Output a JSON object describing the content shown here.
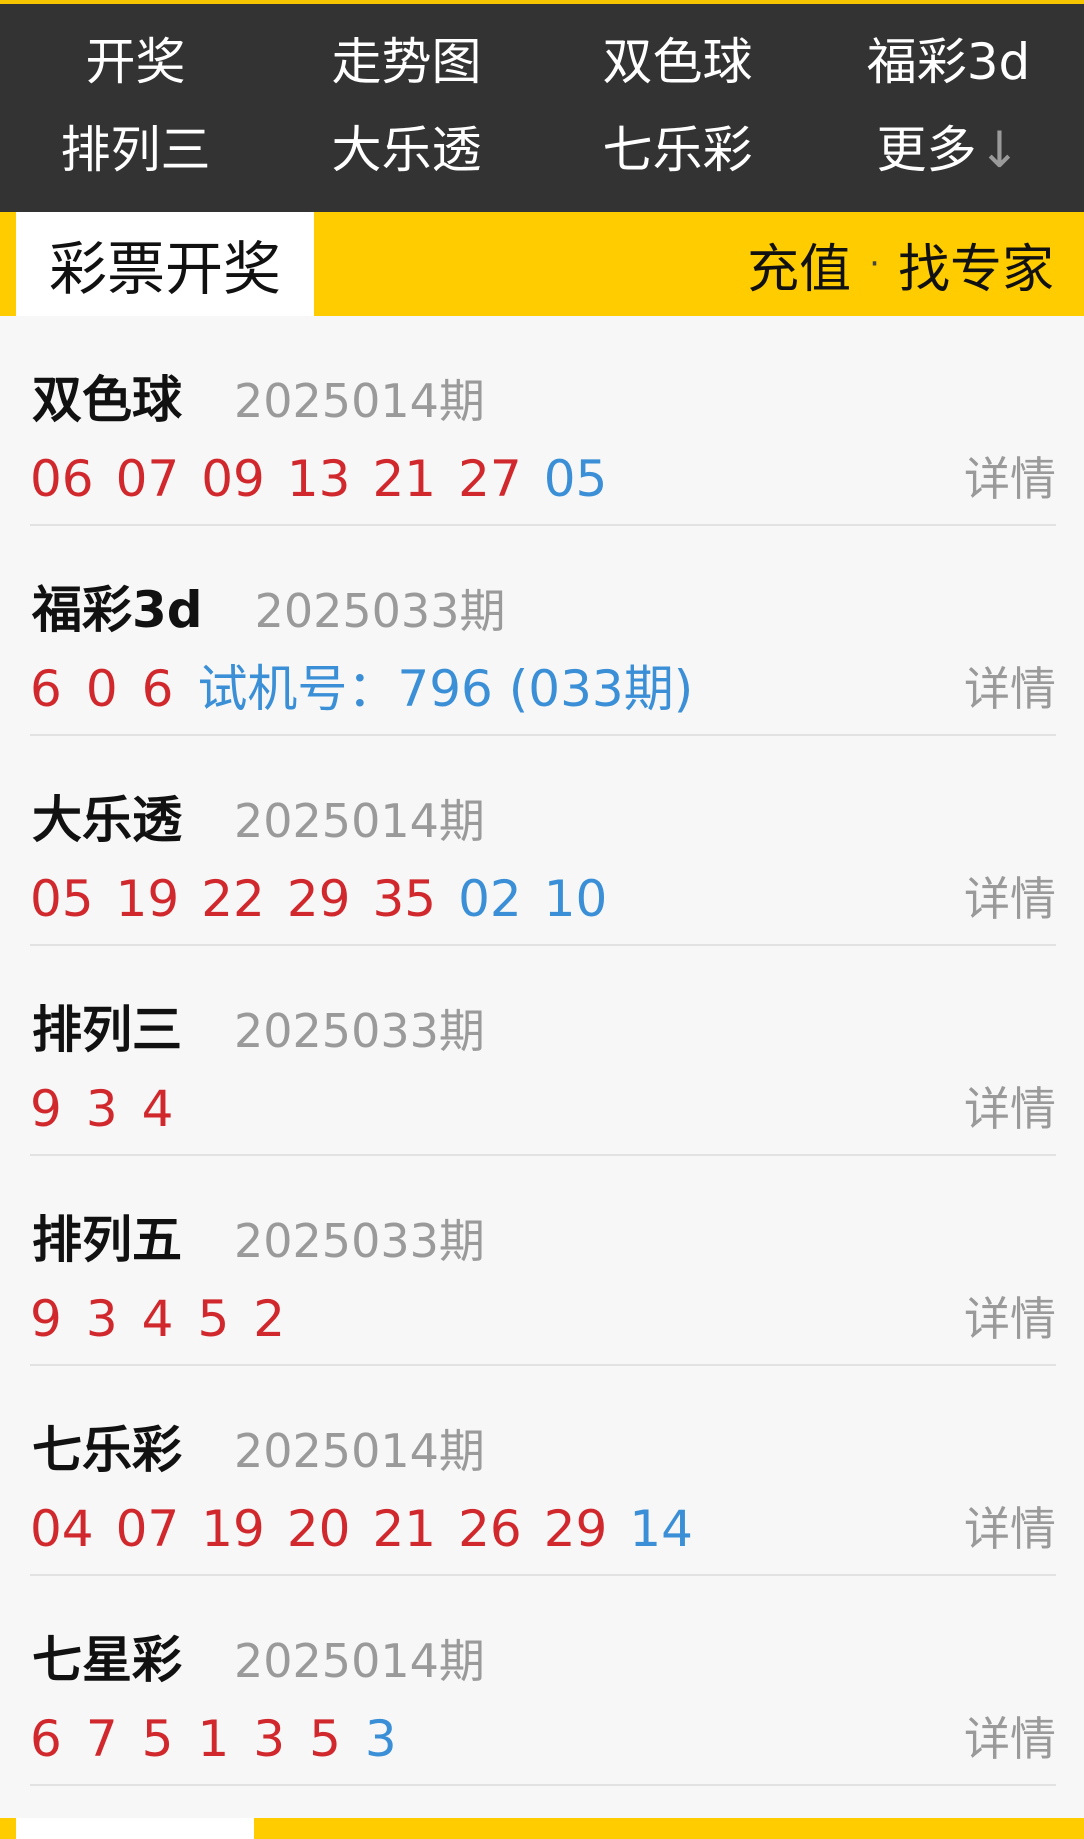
{
  "nav": {
    "items": [
      "开奖",
      "走势图",
      "双色球",
      "福彩3d",
      "排列三",
      "大乐透",
      "七乐彩",
      "更多"
    ]
  },
  "section": {
    "tab_label": "彩票开奖",
    "link_recharge": "充值",
    "separator": "·",
    "link_expert": "找专家"
  },
  "lotteries": [
    {
      "name": "双色球",
      "period": "2025014期",
      "red": [
        "06",
        "07",
        "09",
        "13",
        "21",
        "27"
      ],
      "blue": [
        "05"
      ],
      "extra": "",
      "detail": "详情"
    },
    {
      "name": "福彩3d",
      "period": "2025033期",
      "red": [
        "6",
        "0",
        "6"
      ],
      "blue": [],
      "extra": "试机号：796 (033期)",
      "detail": "详情"
    },
    {
      "name": "大乐透",
      "period": "2025014期",
      "red": [
        "05",
        "19",
        "22",
        "29",
        "35"
      ],
      "blue": [
        "02",
        "10"
      ],
      "extra": "",
      "detail": "详情"
    },
    {
      "name": "排列三",
      "period": "2025033期",
      "red": [
        "9",
        "3",
        "4"
      ],
      "blue": [],
      "extra": "",
      "detail": "详情"
    },
    {
      "name": "排列五",
      "period": "2025033期",
      "red": [
        "9",
        "3",
        "4",
        "5",
        "2"
      ],
      "blue": [],
      "extra": "",
      "detail": "详情"
    },
    {
      "name": "七乐彩",
      "period": "2025014期",
      "red": [
        "04",
        "07",
        "19",
        "20",
        "21",
        "26",
        "29"
      ],
      "blue": [
        "14"
      ],
      "extra": "",
      "detail": "详情"
    },
    {
      "name": "七星彩",
      "period": "2025014期",
      "red": [
        "6",
        "7",
        "5",
        "1",
        "3",
        "5"
      ],
      "blue": [
        "3"
      ],
      "extra": "",
      "detail": "详情"
    }
  ],
  "colors": {
    "nav_bg": "#333333",
    "accent_yellow": "#ffcc00",
    "red_ball": "#d0282c",
    "blue_ball": "#3a8fd6",
    "muted_text": "#9a9a9a"
  },
  "icons": {
    "more_arrow": "arrow-down-icon"
  }
}
